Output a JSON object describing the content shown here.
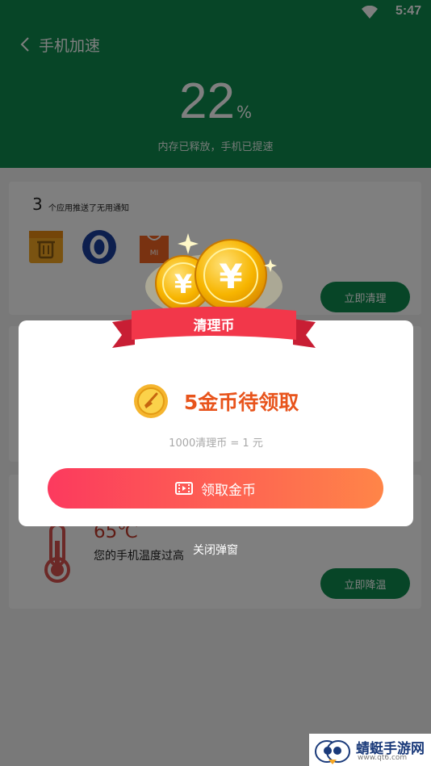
{
  "status_bar": {
    "time": "5:47",
    "wifi_icon": "wifi-icon"
  },
  "header": {
    "title": "手机加速",
    "percent": "22",
    "percent_unit": "%",
    "subtitle": "内存已释放，手机已提速"
  },
  "notification_card": {
    "count": "3",
    "text": "个应用推送了无用通知",
    "app_icons": [
      "calendar-trash-app-icon",
      "blue-o-app-icon",
      "mi-store-app-icon"
    ],
    "button_label": "立即清理"
  },
  "temperature_card": {
    "temperature": "65℃",
    "description": "您的手机温度过高",
    "button_label": "立即降温"
  },
  "popup": {
    "ribbon_label": "清理币",
    "reward_text": "5金币待领取",
    "exchange_rate": "1000清理币 = 1 元",
    "claim_button_label": "领取金币",
    "close_label": "关闭弹窗"
  },
  "watermark": {
    "name": "蜻蜓手游网",
    "url": "www.qt6.com"
  },
  "colors": {
    "brand_green": "#0e8a4e",
    "reward_orange": "#e8541c",
    "button_gradient_start": "#fc3a5e",
    "button_gradient_end": "#ff8548",
    "ribbon_red": "#f2374a"
  }
}
